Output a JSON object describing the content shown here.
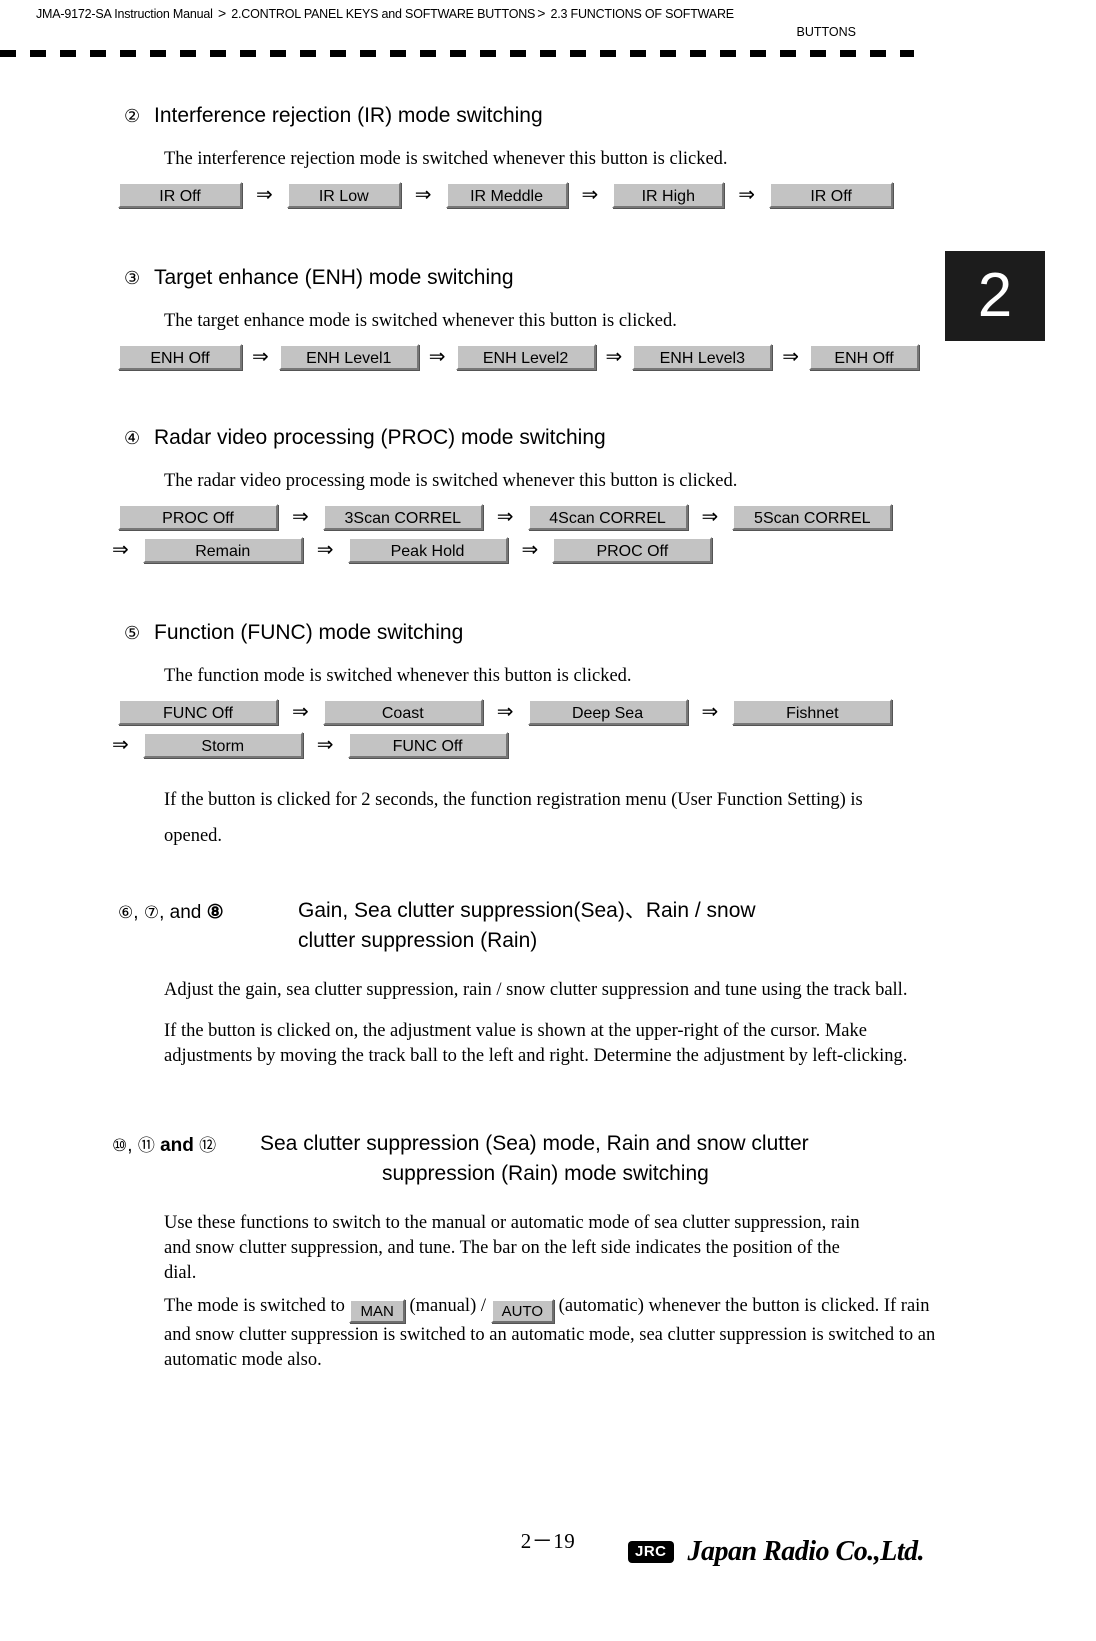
{
  "header": {
    "manual": "JMA-9172-SA Instruction Manual",
    "sep1": ">",
    "crumb1": "2.CONTROL PANEL KEYS and SOFTWARE BUTTONS",
    "sep2": ">",
    "crumb2": "2.3  FUNCTIONS OF SOFTWARE",
    "crumb2_wrap": "BUTTONS"
  },
  "chapter_tab": "2",
  "sections": [
    {
      "number": "②",
      "title": "Interference rejection (IR) mode switching",
      "body": "The interference rejection mode is switched whenever this button is clicked.",
      "buttons_row1": [
        "IR Off",
        "IR Low",
        "IR Meddle",
        "IR High",
        "IR Off"
      ],
      "widths1": [
        124,
        114,
        122,
        108,
        124
      ]
    },
    {
      "number": "③",
      "title": "Target enhance (ENH) mode switching",
      "body": "The target enhance mode is switched whenever this button is clicked.",
      "buttons_row1": [
        "ENH Off",
        "ENH Level1",
        "ENH Level2",
        "ENH Level3",
        "ENH Off"
      ],
      "widths1": [
        124,
        140,
        140,
        140,
        110
      ]
    },
    {
      "number": "④",
      "title": "Radar video processing (PROC) mode switching",
      "body": "The radar video processing mode is switched whenever this button is clicked.",
      "buttons_row1": [
        "PROC Off",
        "3Scan CORREL",
        "4Scan CORREL",
        "5Scan CORREL"
      ],
      "widths1": [
        160,
        160,
        160,
        160
      ],
      "buttons_row2": [
        "Remain",
        "Peak Hold",
        "PROC Off"
      ],
      "widths2": [
        160,
        160,
        160
      ]
    },
    {
      "number": "⑤",
      "title": "Function (FUNC) mode switching",
      "body": "The function mode is switched whenever this button is clicked.",
      "buttons_row1": [
        "FUNC Off",
        "Coast",
        "Deep Sea",
        "Fishnet"
      ],
      "widths1": [
        160,
        160,
        160,
        160
      ],
      "buttons_row2": [
        "Storm",
        "FUNC Off"
      ],
      "widths2": [
        160,
        160
      ],
      "note": "If the button is clicked for 2 seconds, the function registration menu (User Function Setting) is opened."
    }
  ],
  "section678": {
    "labels": "⑥, ⑦,  and ⑧",
    "label_parts": {
      "n6": "⑥",
      "comma1": ",",
      "n7": "⑦",
      "comma2": ",",
      "and": "and",
      "n8": "⑧"
    },
    "title_line1": "Gain, Sea clutter suppression(Sea)、Rain / snow",
    "title_line2": "clutter suppression (Rain)",
    "para1": "Adjust the gain, sea clutter suppression, rain / snow clutter suppression and tune using the track ball.",
    "para2": "If the button is clicked on, the adjustment value is shown at the upper-right of the cursor. Make adjustments by moving the track ball to the left and right. Determine the adjustment by left-clicking."
  },
  "section101112": {
    "label_parts": {
      "n10": "⑩",
      "comma1": ",",
      "n11": "⑪",
      "and": "and",
      "n12": "⑫"
    },
    "title_line1": "Sea clutter suppression (Sea) mode, Rain and snow clutter",
    "title_line2": "suppression (Rain) mode switching",
    "para1": "Use these functions to switch to the manual or automatic mode of sea clutter suppression, rain and snow clutter suppression, and tune. The bar on the left side indicates the position of the dial.",
    "para2_a": "The mode is switched to",
    "btn_man": "MAN",
    "para2_b": "(manual) /",
    "btn_auto": "AUTO",
    "para2_c": "(automatic) whenever the",
    "para2_rest": "button is clicked. If rain and snow clutter suppression is switched to an automatic mode, sea clutter suppression is switched to an automatic mode also."
  },
  "footer": {
    "page_number": "2－19",
    "logo_badge": "JRC",
    "logo_name": "Japan Radio Co.,Ltd."
  },
  "colors": {
    "button_face": "#c3c3c3",
    "button_light": "#ffffff",
    "button_shadow": "#777777",
    "tab_bg": "#1c1c1c",
    "text": "#000000"
  }
}
